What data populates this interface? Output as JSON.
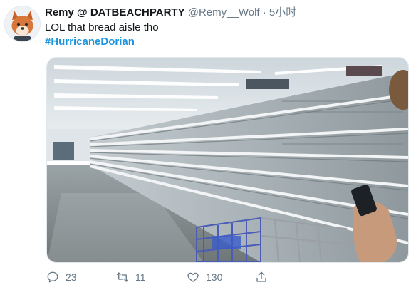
{
  "tweet": {
    "display_name": "Remy @ DATBEACHPARTY",
    "handle": "@Remy__Wolf",
    "separator": "·",
    "time": "5小时",
    "text": "LOL that bread aisle tho",
    "hashtag": "#HurricaneDorian"
  },
  "actions": {
    "reply_count": "23",
    "retweet_count": "11",
    "like_count": "130"
  },
  "icons": {
    "avatar": "wolf-avatar",
    "reply": "reply-icon",
    "retweet": "retweet-icon",
    "like": "heart-icon",
    "share": "share-icon"
  },
  "colors": {
    "hashtag": "#1b95e0",
    "secondary_text": "#657786",
    "primary_text": "#14171a"
  }
}
